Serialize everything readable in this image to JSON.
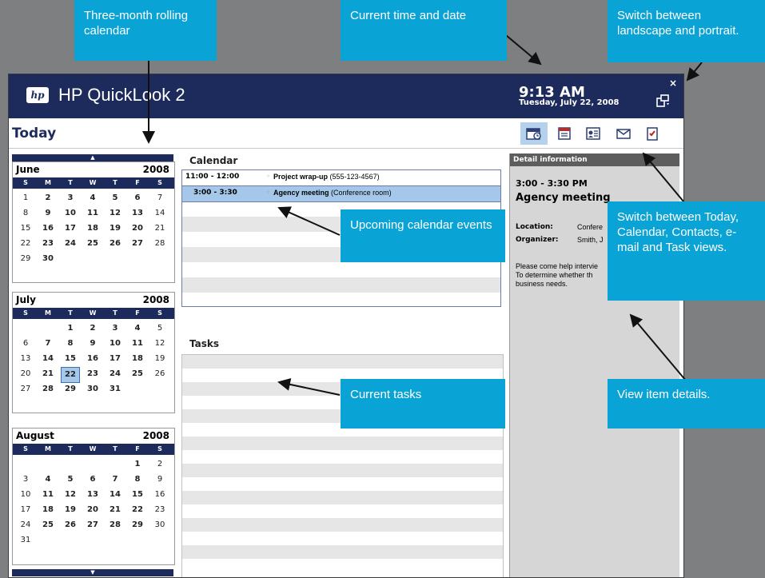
{
  "app": {
    "title": "HP QuickLook 2",
    "logo_text": "hp",
    "time": "9:13 AM",
    "date": "Tuesday, July 22, 2008",
    "close_glyph": "×"
  },
  "views": [
    {
      "name": "today-view",
      "icon": "today-icon",
      "selected": true
    },
    {
      "name": "calendar-view",
      "icon": "calendar-icon",
      "selected": false
    },
    {
      "name": "contacts-view",
      "icon": "contacts-icon",
      "selected": false
    },
    {
      "name": "email-view",
      "icon": "email-icon",
      "selected": false
    },
    {
      "name": "tasks-view",
      "icon": "tasks-icon",
      "selected": false
    }
  ],
  "page": {
    "title": "Today"
  },
  "minical": {
    "nav_up": "▲",
    "nav_down": "▼",
    "dow": [
      "S",
      "M",
      "T",
      "W",
      "T",
      "F",
      "S"
    ],
    "selected_day": "22",
    "months": [
      {
        "name": "June",
        "year": "2008",
        "weeks": [
          [
            "1",
            "2",
            "3",
            "4",
            "5",
            "6",
            "7"
          ],
          [
            "8",
            "9",
            "10",
            "11",
            "12",
            "13",
            "14"
          ],
          [
            "15",
            "16",
            "17",
            "18",
            "19",
            "20",
            "21"
          ],
          [
            "22",
            "23",
            "24",
            "25",
            "26",
            "27",
            "28"
          ],
          [
            "29",
            "30",
            "",
            "",
            "",
            "",
            ""
          ]
        ]
      },
      {
        "name": "July",
        "year": "2008",
        "weeks": [
          [
            "",
            "",
            "1",
            "2",
            "3",
            "4",
            "5"
          ],
          [
            "6",
            "7",
            "8",
            "9",
            "10",
            "11",
            "12"
          ],
          [
            "13",
            "14",
            "15",
            "16",
            "17",
            "18",
            "19"
          ],
          [
            "20",
            "21",
            "22",
            "23",
            "24",
            "25",
            "26"
          ],
          [
            "27",
            "28",
            "29",
            "30",
            "31",
            "",
            ""
          ]
        ]
      },
      {
        "name": "August",
        "year": "2008",
        "weeks": [
          [
            "",
            "",
            "",
            "",
            "",
            "1",
            "2"
          ],
          [
            "3",
            "4",
            "5",
            "6",
            "7",
            "8",
            "9"
          ],
          [
            "10",
            "11",
            "12",
            "13",
            "14",
            "15",
            "16"
          ],
          [
            "17",
            "18",
            "19",
            "20",
            "21",
            "22",
            "23"
          ],
          [
            "24",
            "25",
            "26",
            "27",
            "28",
            "29",
            "30"
          ],
          [
            "31",
            "",
            "",
            "",
            "",
            "",
            ""
          ]
        ]
      }
    ]
  },
  "calendar": {
    "title": "Calendar",
    "events": [
      {
        "time": "11:00 - 12:00",
        "subject": "Project wrap-up",
        "location": "(555-123-4567)",
        "selected": false
      },
      {
        "time": "3:00 -  3:30",
        "subject": "Agency meeting",
        "location": "(Conference room)",
        "selected": true
      }
    ]
  },
  "tasks": {
    "title": "Tasks"
  },
  "detail": {
    "header": "Detail information",
    "time": "3:00 - 3:30 PM",
    "subject": "Agency meeting",
    "location_label": "Location:",
    "location_value": "Confere",
    "organizer_label": "Organizer:",
    "organizer_value": "Smith, J",
    "body_lines": [
      "Please come help intervie",
      "To determine whether th",
      "business needs."
    ]
  },
  "callouts": {
    "rolling_calendar": "Three-month rolling calendar",
    "time_date": "Current time and date",
    "orientation": "Switch between landscape and portrait.",
    "upcoming_events": "Upcoming calendar events",
    "switch_views": "Switch between Today, Calendar, Contacts, e-mail and Task views.",
    "current_tasks": "Current tasks",
    "view_details": "View item details."
  },
  "colors": {
    "titlebar": "#1d2b5c",
    "callout": "#0aa3d6",
    "selection": "#a5c8ea",
    "background": "#7e7f81"
  }
}
